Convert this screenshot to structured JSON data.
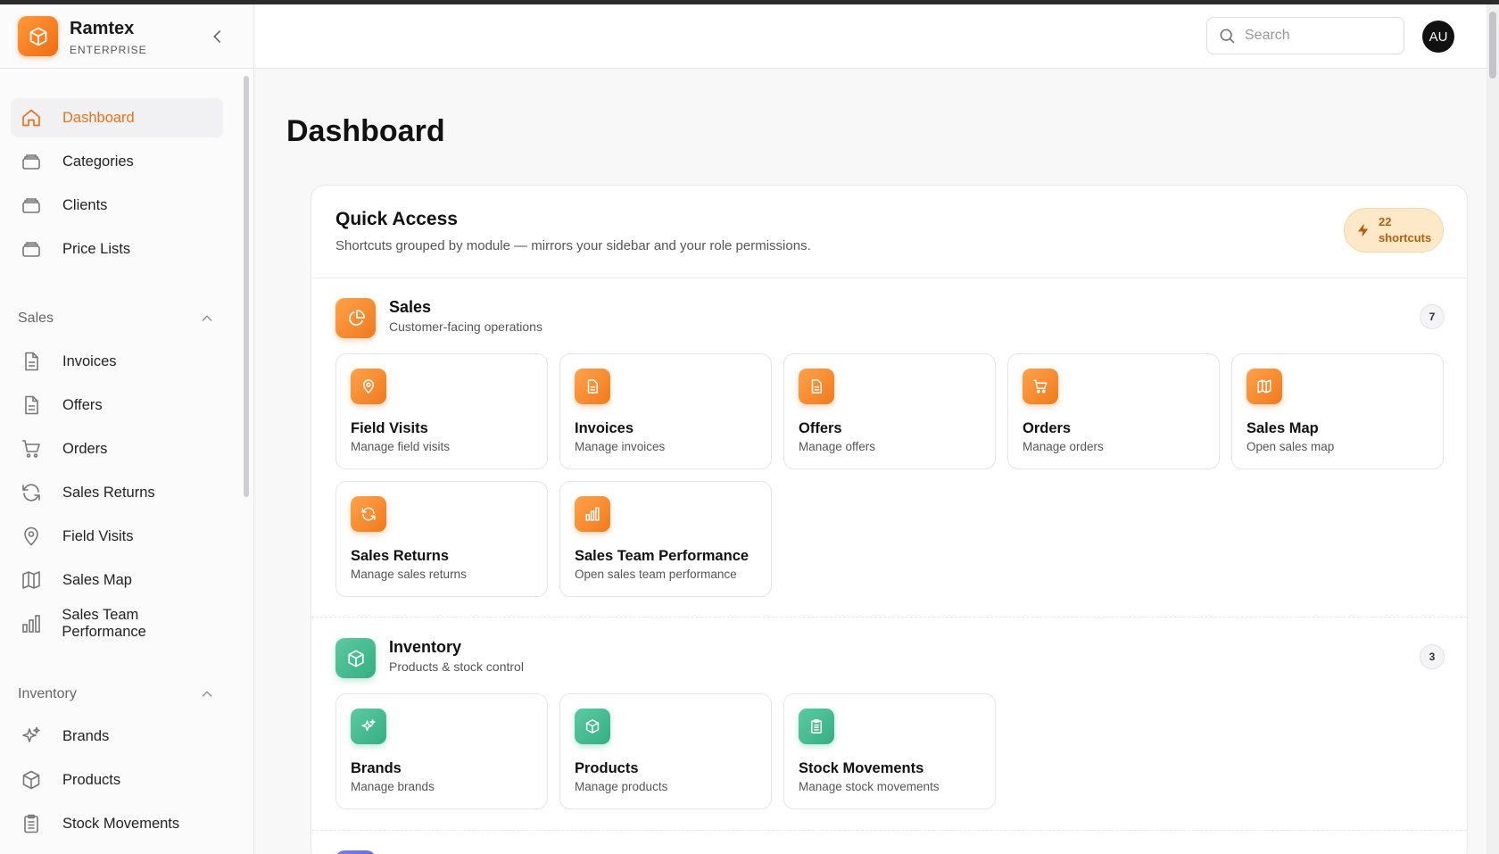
{
  "brand": {
    "name": "Ramtex",
    "sub": "ENTERPRISE"
  },
  "sidebar": {
    "top_items": [
      {
        "label": "Dashboard",
        "icon": "home-icon",
        "active": true
      },
      {
        "label": "Categories",
        "icon": "layers-icon"
      },
      {
        "label": "Clients",
        "icon": "layers-icon"
      },
      {
        "label": "Price Lists",
        "icon": "layers-icon"
      }
    ],
    "sales_section": "Sales",
    "sales_items": [
      {
        "label": "Invoices",
        "icon": "file-icon"
      },
      {
        "label": "Offers",
        "icon": "file-icon"
      },
      {
        "label": "Orders",
        "icon": "cart-icon"
      },
      {
        "label": "Sales Returns",
        "icon": "refresh-icon"
      },
      {
        "label": "Field Visits",
        "icon": "map-pin-icon"
      },
      {
        "label": "Sales Map",
        "icon": "map-icon"
      },
      {
        "label": "Sales Team Performance",
        "icon": "bar-chart-icon"
      }
    ],
    "inventory_section": "Inventory",
    "inventory_items": [
      {
        "label": "Brands",
        "icon": "sparkles-icon"
      },
      {
        "label": "Products",
        "icon": "box-icon"
      },
      {
        "label": "Stock Movements",
        "icon": "clipboard-icon"
      }
    ]
  },
  "header": {
    "search_placeholder": "Search",
    "avatar": "AU"
  },
  "page": {
    "title": "Dashboard"
  },
  "quick_access": {
    "title": "Quick Access",
    "subtitle": "Shortcuts grouped by module — mirrors your sidebar and your role permissions.",
    "badge_count": "22",
    "badge_label": "shortcuts",
    "groups": [
      {
        "title": "Sales",
        "subtitle": "Customer-facing operations",
        "count": "7",
        "color": "#f07a1e",
        "tiles": [
          {
            "title": "Field Visits",
            "desc": "Manage field visits",
            "icon": "map-pin-icon"
          },
          {
            "title": "Invoices",
            "desc": "Manage invoices",
            "icon": "file-icon"
          },
          {
            "title": "Offers",
            "desc": "Manage offers",
            "icon": "file-icon"
          },
          {
            "title": "Orders",
            "desc": "Manage orders",
            "icon": "cart-icon"
          },
          {
            "title": "Sales Map",
            "desc": "Open sales map",
            "icon": "map-icon"
          },
          {
            "title": "Sales Returns",
            "desc": "Manage sales returns",
            "icon": "refresh-icon"
          },
          {
            "title": "Sales Team Performance",
            "desc": "Open sales team performance",
            "icon": "bar-chart-icon"
          }
        ]
      },
      {
        "title": "Inventory",
        "subtitle": "Products & stock control",
        "count": "3",
        "color": "#35ae84",
        "tiles": [
          {
            "title": "Brands",
            "desc": "Manage brands",
            "icon": "sparkles-icon"
          },
          {
            "title": "Products",
            "desc": "Manage products",
            "icon": "box-icon"
          },
          {
            "title": "Stock Movements",
            "desc": "Manage stock movements",
            "icon": "clipboard-icon"
          }
        ]
      }
    ]
  },
  "colors": {
    "accent": "#e8731c",
    "sales": "#f07a1e",
    "inventory": "#35ae84"
  }
}
